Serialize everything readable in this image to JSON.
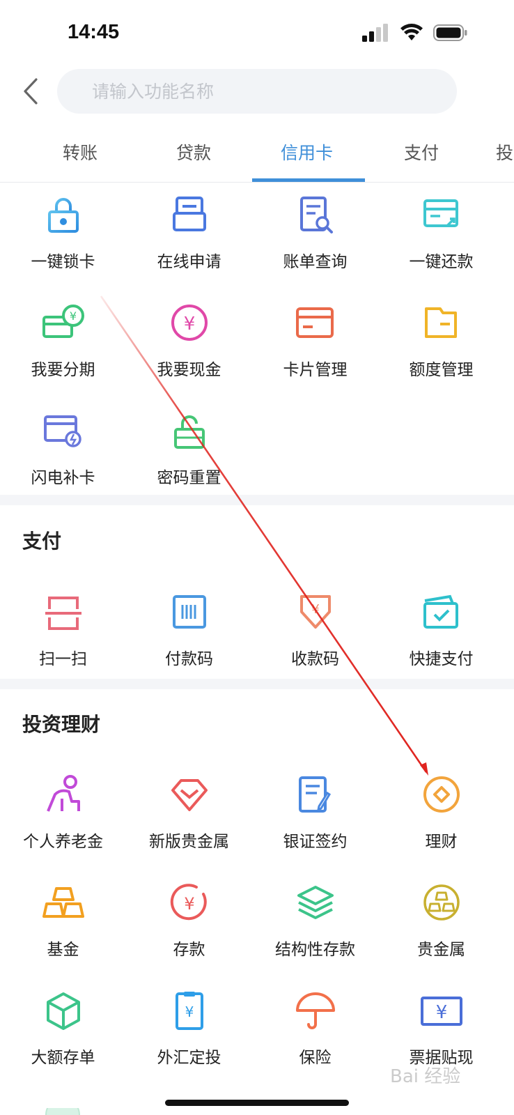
{
  "status": {
    "time": "14:45"
  },
  "search": {
    "placeholder": "请输入功能名称"
  },
  "tabs": [
    "转账",
    "贷款",
    "信用卡",
    "支付",
    "投"
  ],
  "active_tab": "信用卡",
  "credit_card": {
    "items": [
      {
        "label": "一键锁卡",
        "icon": "lock-icon"
      },
      {
        "label": "在线申请",
        "icon": "online-apply-icon"
      },
      {
        "label": "账单查询",
        "icon": "bill-search-icon"
      },
      {
        "label": "一键还款",
        "icon": "repay-icon"
      },
      {
        "label": "我要分期",
        "icon": "installment-icon"
      },
      {
        "label": "我要现金",
        "icon": "cash-icon"
      },
      {
        "label": "卡片管理",
        "icon": "card-manage-icon"
      },
      {
        "label": "额度管理",
        "icon": "limit-manage-icon"
      },
      {
        "label": "闪电补卡",
        "icon": "flash-card-icon"
      },
      {
        "label": "密码重置",
        "icon": "unlock-icon"
      }
    ]
  },
  "payment": {
    "title": "支付",
    "items": [
      {
        "label": "扫一扫",
        "icon": "scan-icon"
      },
      {
        "label": "付款码",
        "icon": "pay-code-icon"
      },
      {
        "label": "收款码",
        "icon": "receive-code-icon"
      },
      {
        "label": "快捷支付",
        "icon": "quick-pay-icon"
      }
    ]
  },
  "investment": {
    "title": "投资理财",
    "items": [
      {
        "label": "个人养老金",
        "icon": "pension-icon"
      },
      {
        "label": "新版贵金属",
        "icon": "diamond-icon"
      },
      {
        "label": "银证签约",
        "icon": "sign-document-icon"
      },
      {
        "label": "理财",
        "icon": "coin-icon"
      },
      {
        "label": "基金",
        "icon": "gold-bars-icon"
      },
      {
        "label": "存款",
        "icon": "deposit-icon"
      },
      {
        "label": "结构性存款",
        "icon": "layers-icon"
      },
      {
        "label": "贵金属",
        "icon": "gold-coin-icon"
      },
      {
        "label": "大额存单",
        "icon": "cube-icon"
      },
      {
        "label": "外汇定投",
        "icon": "forex-icon"
      },
      {
        "label": "保险",
        "icon": "umbrella-icon"
      },
      {
        "label": "票据贴现",
        "icon": "bill-discount-icon"
      }
    ]
  },
  "colors": {
    "accent": "#3f8fd9",
    "annotation_arrow": "#e0241f"
  },
  "watermark": "Bai 经验"
}
